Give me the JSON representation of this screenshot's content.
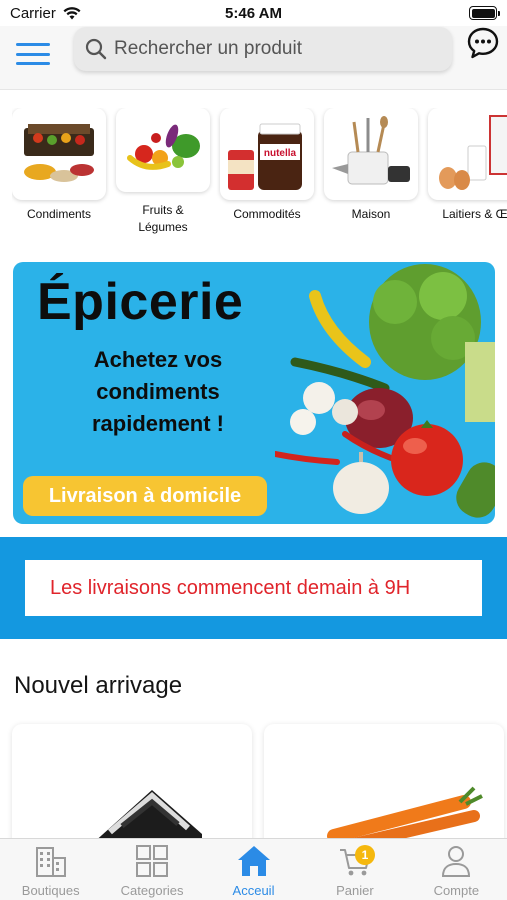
{
  "status_bar": {
    "carrier": "Carrier",
    "time": "5:46 AM"
  },
  "header": {
    "search": {
      "placeholder": "Rechercher un produit"
    }
  },
  "categories": [
    {
      "label": "Condiments"
    },
    {
      "label": "Fruits & Légumes"
    },
    {
      "label": "Commodités"
    },
    {
      "label": "Maison"
    },
    {
      "label": "Laitiers & Œ"
    }
  ],
  "banner": {
    "title": "Épicerie",
    "subtitle": "Achetez vos condiments rapidement !",
    "button": "Livraison  à domicile"
  },
  "notice": {
    "text": "Les livraisons commencent demain à 9H"
  },
  "new_arrivals": {
    "title": "Nouvel arrivage"
  },
  "tab_bar": {
    "tabs": [
      {
        "label": "Boutiques",
        "icon": "buildings-icon"
      },
      {
        "label": "Categories",
        "icon": "grid-icon"
      },
      {
        "label": "Acceuil",
        "icon": "home-icon",
        "active": true
      },
      {
        "label": "Panier",
        "icon": "cart-icon",
        "badge": "1"
      },
      {
        "label": "Compte",
        "icon": "user-icon"
      }
    ]
  },
  "colors": {
    "accent": "#2b8be6",
    "banner_bg": "#2bb2e8",
    "notice_band": "#1498e0",
    "notice_text": "#e0242b",
    "badge": "#f5b80e",
    "banner_button": "#f7c532"
  }
}
